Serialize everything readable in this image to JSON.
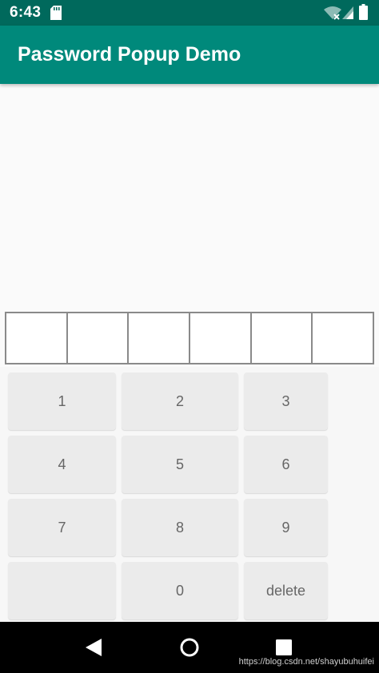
{
  "status_bar": {
    "time": "6:43",
    "icons": [
      "sd-card-icon",
      "wifi-off-icon",
      "cell-signal-icon",
      "battery-icon"
    ]
  },
  "app_bar": {
    "title": "Password Popup Demo",
    "color": "#00897b",
    "status_color": "#00695c"
  },
  "password": {
    "length": 6,
    "digits": [
      "",
      "",
      "",
      "",
      "",
      ""
    ]
  },
  "keypad": {
    "keys": [
      {
        "label": "1"
      },
      {
        "label": "2"
      },
      {
        "label": "3"
      },
      {
        "label": "4"
      },
      {
        "label": "5"
      },
      {
        "label": "6"
      },
      {
        "label": "7"
      },
      {
        "label": "8"
      },
      {
        "label": "9"
      },
      {
        "label": ""
      },
      {
        "label": "0"
      },
      {
        "label": "delete"
      }
    ]
  },
  "nav_bar": {
    "icons": [
      "back-icon",
      "home-icon",
      "recents-icon"
    ]
  },
  "watermark": "https://blog.csdn.net/shayubuhuifei"
}
